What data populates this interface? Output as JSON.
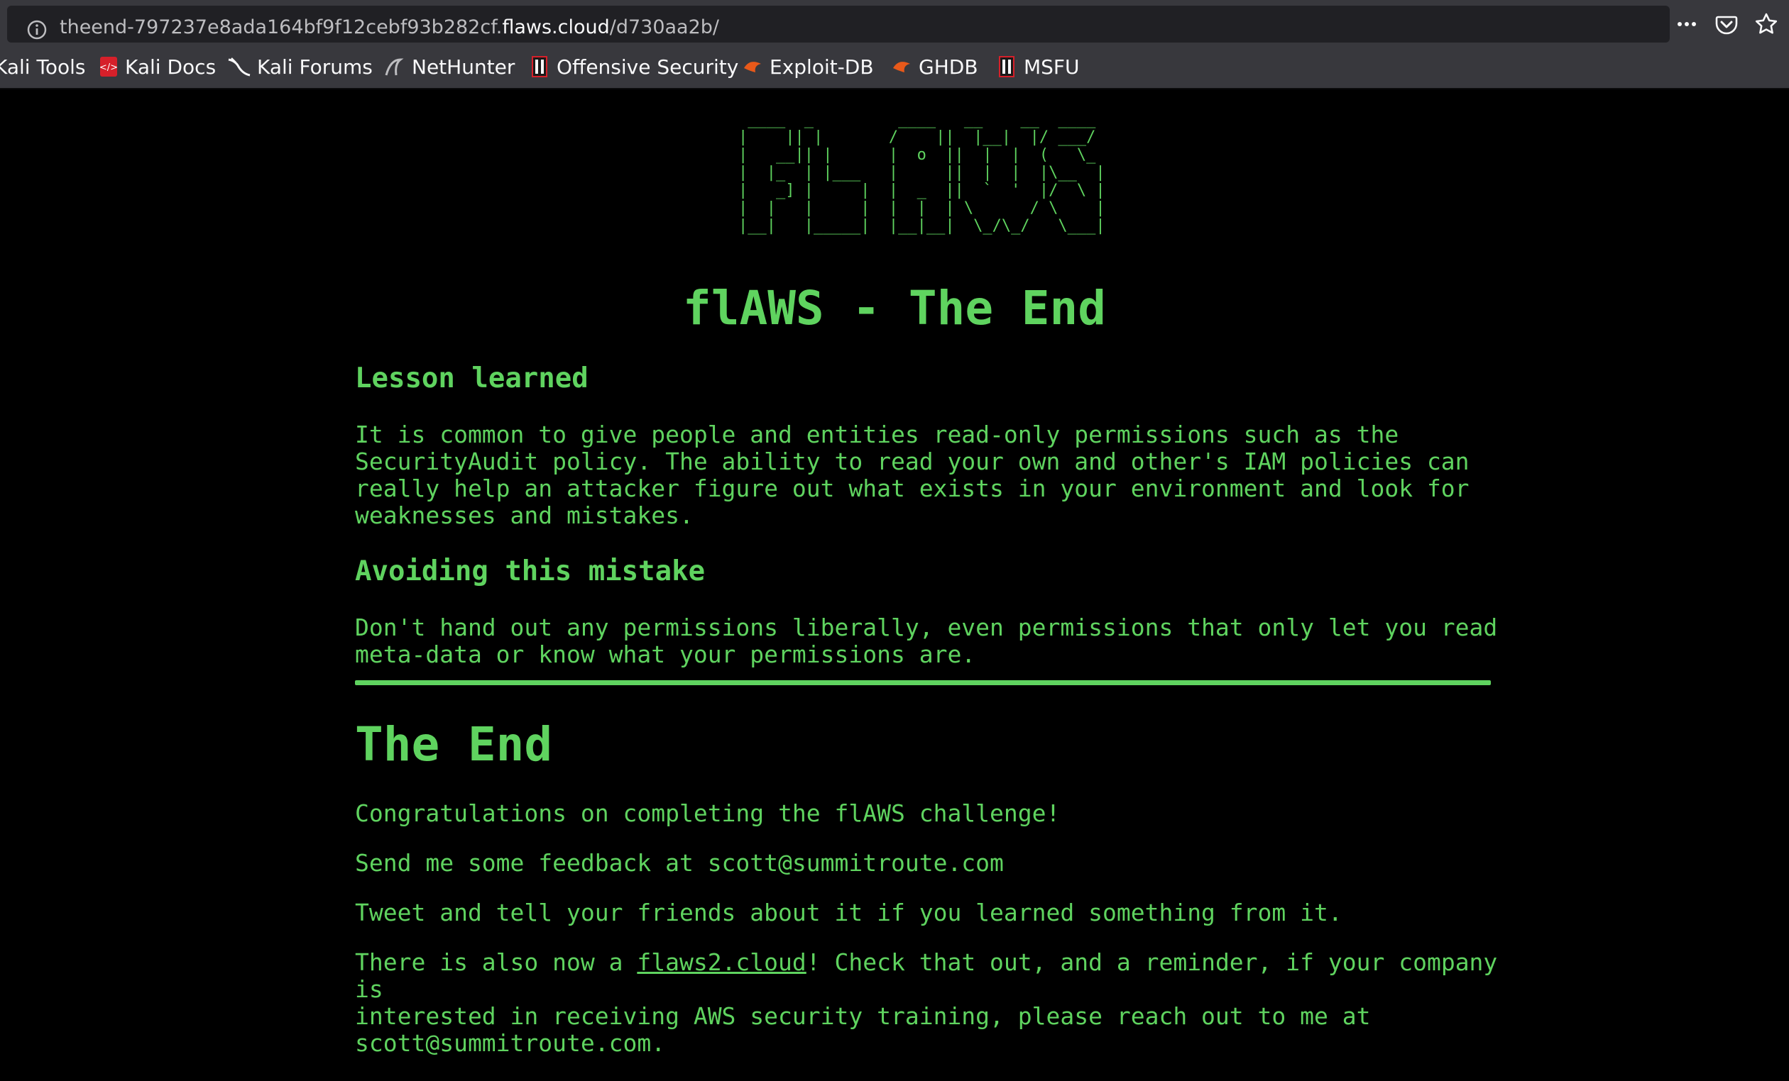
{
  "browser": {
    "url_prefix": "theend-797237e8ada164bf9f12cebf93b282cf.",
    "url_domain": "flaws.cloud",
    "url_path": "/d730aa2b/",
    "bookmarks": [
      {
        "label": "Kali Tools",
        "icon": "kali-dragon-icon"
      },
      {
        "label": "Kali Docs",
        "icon": "kali-docs-icon"
      },
      {
        "label": "Kali Forums",
        "icon": "kali-dragon-icon"
      },
      {
        "label": "NetHunter",
        "icon": "nethunter-icon"
      },
      {
        "label": "Offensive Security",
        "icon": "offsec-icon"
      },
      {
        "label": "Exploit-DB",
        "icon": "exploitdb-icon"
      },
      {
        "label": "GHDB",
        "icon": "ghdb-icon"
      },
      {
        "label": "MSFU",
        "icon": "msfu-icon"
      }
    ]
  },
  "page": {
    "ascii_logo": " ____  _         ____   __    __  ____\n|    || |       /    ||  |__|  |/ ___/\n|   __|| |      |  o  ||  |  |  (   \\_\n|  |_  | |___   |     ||  |  |  |\\__  |\n|   _] |     |  |  _  ||  `  '  |/  \\ |\n|  |   |     |  |  |  | \\      / \\    |\n|__|   |_____|  |__|__|  \\_/\\_/   \\___|",
    "title": "flAWS - The End",
    "lesson_heading": "Lesson learned",
    "lesson_text": "It is common to give people and entities read-only permissions such as the\nSecurityAudit policy. The ability to read your own and other's IAM policies can\nreally help an attacker figure out what exists in your environment and look for\nweaknesses and mistakes.",
    "avoid_heading": "Avoiding this mistake",
    "avoid_text": "Don't hand out any permissions liberally, even permissions that only let you read\nmeta-data or know what your permissions are.",
    "end_title": "The End",
    "congrats": "Congratulations on completing the flAWS challenge!",
    "feedback": "Send me some feedback at scott@summitroute.com",
    "tweet": "Tweet and tell your friends about it if you learned something from it.",
    "final_prefix": "There is also now a ",
    "final_link": "flaws2.cloud",
    "final_suffix": "! Check that out, and a reminder, if your company is\ninterested in receiving AWS security training, please reach out to me at\nscott@summitroute.com."
  },
  "colors": {
    "accent": "#5fd35f",
    "background": "#000000",
    "toolbar": "#38383d"
  }
}
